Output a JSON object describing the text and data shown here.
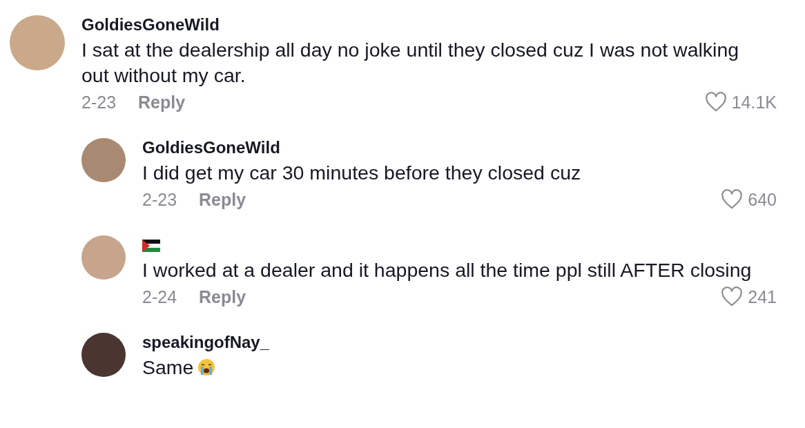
{
  "comments": [
    {
      "author": "GoldiesGoneWild",
      "text": "I sat at the dealership all day no joke until they closed cuz I was not walking out without my car.",
      "date": "2-23",
      "reply_label": "Reply",
      "likes": "14.1K",
      "children": [
        {
          "author": "GoldiesGoneWild",
          "text": "I did get my car 30 minutes before they closed cuz",
          "date": "2-23",
          "reply_label": "Reply",
          "likes": "640"
        },
        {
          "kind": "flag_author",
          "text": "I worked at a dealer and it happens all the time ppl still AFTER closing",
          "date": "2-24",
          "reply_label": "Reply",
          "likes": "241"
        },
        {
          "kind": "emoji_end",
          "author": "speakingofNay_",
          "text": "Same"
        }
      ]
    }
  ]
}
